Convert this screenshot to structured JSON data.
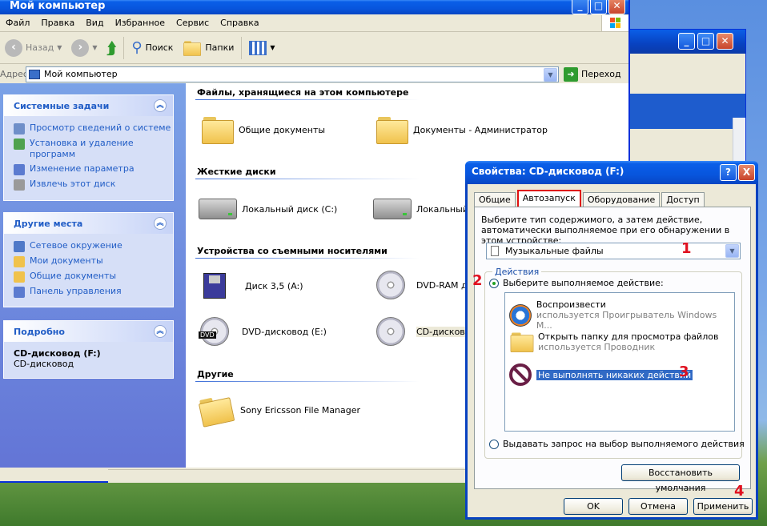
{
  "main_window": {
    "title": "Мой компьютер",
    "menu": [
      "Файл",
      "Правка",
      "Вид",
      "Избранное",
      "Сервис",
      "Справка"
    ],
    "toolbar": {
      "back": "Назад",
      "search": "Поиск",
      "folders": "Папки"
    },
    "address": {
      "label": "Адрес:",
      "value": "Мой компьютер",
      "go": "Переход"
    }
  },
  "left_pane": {
    "system_tasks": {
      "title": "Системные задачи",
      "items": [
        "Просмотр сведений о системе",
        "Установка и удаление программ",
        "Изменение параметра",
        "Извлечь этот диск"
      ]
    },
    "other_places": {
      "title": "Другие места",
      "items": [
        "Сетевое окружение",
        "Мои документы",
        "Общие документы",
        "Панель управления"
      ]
    },
    "details": {
      "title": "Подробно",
      "name": "CD-дисковод (F:)",
      "type": "CD-дисковод"
    }
  },
  "content": {
    "sections": {
      "stored": "Файлы, хранящиеся на этом компьютере",
      "hard": "Жесткие диски",
      "removable": "Устройства со съемными носителями",
      "other": "Другие"
    },
    "stored_items": [
      "Общие документы",
      "Документы - Администратор"
    ],
    "hard_items": [
      "Локальный диск (C:)",
      "Локальный д"
    ],
    "removable_items": [
      "Диск 3,5 (A:)",
      "DVD-RAM ди",
      "DVD-дисковод (E:)",
      "CD-дисково"
    ],
    "other_items": [
      "Sony Ericsson File Manager"
    ],
    "dvd_badge": "DVD"
  },
  "dialog": {
    "title": "Свойства: CD-дисковод (F:)",
    "tabs": [
      "Общие",
      "Автозапуск",
      "Оборудование",
      "Доступ"
    ],
    "active_tab": "Автозапуск",
    "description": "Выберите тип содержимого, а затем действие, автоматически выполняемое при его обнаружении в этом устройстве:",
    "content_type": "Музыкальные файлы",
    "actions_group": "Действия",
    "radio_select": "Выберите выполняемое действие:",
    "actions": [
      {
        "title": "Воспроизвести",
        "subtitle": "используется Проигрыватель Windows M..."
      },
      {
        "title": "Открыть папку для просмотра файлов",
        "subtitle": "используется Проводник"
      },
      {
        "title": "Не выполнять никаких действий",
        "subtitle": ""
      }
    ],
    "radio_prompt": "Выдавать запрос на выбор выполняемого действия",
    "restore": "Восстановить умолчания",
    "ok": "OK",
    "cancel": "Отмена",
    "apply": "Применить",
    "help_btn": "?",
    "close_btn": "X"
  },
  "annotations": [
    "1",
    "2",
    "3",
    "4"
  ],
  "colors": {
    "xp_blue": "#0a5fe8",
    "link": "#215dc6",
    "annotation": "#e0101f",
    "selection": "#316ac5"
  }
}
